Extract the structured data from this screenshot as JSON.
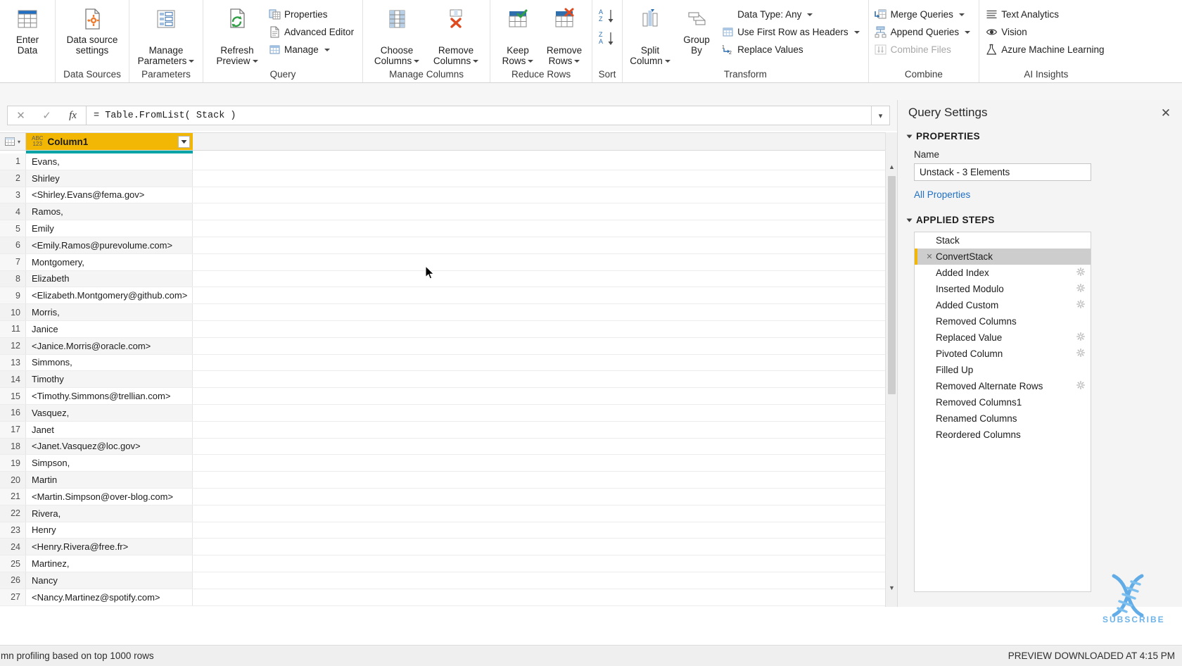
{
  "ribbon": {
    "groups": [
      {
        "name": "clipboard-partial",
        "label": "",
        "buttons": [
          {
            "label": "Enter\nData",
            "icon": "table-icon"
          }
        ]
      },
      {
        "name": "data-sources",
        "label": "Data Sources",
        "buttons": [
          {
            "label": "Data source\nsettings",
            "icon": "data-source-settings-icon"
          }
        ]
      },
      {
        "name": "parameters",
        "label": "Parameters",
        "buttons": [
          {
            "label": "Manage\nParameters",
            "icon": "manage-parameters-icon",
            "dropdown": true
          }
        ]
      },
      {
        "name": "query",
        "label": "Query",
        "buttons": [
          {
            "label": "Refresh\nPreview",
            "icon": "refresh-icon",
            "dropdown": true
          }
        ],
        "small": [
          {
            "label": "Properties",
            "icon": "properties-icon"
          },
          {
            "label": "Advanced Editor",
            "icon": "advanced-editor-icon"
          },
          {
            "label": "Manage",
            "icon": "manage-icon",
            "dropdown": true
          }
        ]
      },
      {
        "name": "manage-columns",
        "label": "Manage Columns",
        "buttons": [
          {
            "label": "Choose\nColumns",
            "icon": "choose-columns-icon",
            "dropdown": true
          },
          {
            "label": "Remove\nColumns",
            "icon": "remove-columns-icon",
            "dropdown": true
          }
        ]
      },
      {
        "name": "reduce-rows",
        "label": "Reduce Rows",
        "buttons": [
          {
            "label": "Keep\nRows",
            "icon": "keep-rows-icon",
            "dropdown": true
          },
          {
            "label": "Remove\nRows",
            "icon": "remove-rows-icon",
            "dropdown": true
          }
        ]
      },
      {
        "name": "sort",
        "label": "Sort",
        "buttons": [
          {
            "label": "",
            "icon": "sort-ascending-icon"
          },
          {
            "label": "",
            "icon": "sort-descending-icon"
          }
        ]
      },
      {
        "name": "transform",
        "label": "Transform",
        "buttons": [
          {
            "label": "Split\nColumn",
            "icon": "split-column-icon",
            "dropdown": true
          },
          {
            "label": "Group\nBy",
            "icon": "group-by-icon"
          }
        ],
        "small": [
          {
            "label": "Data Type: Any",
            "icon": "data-type-icon",
            "dropdown": true
          },
          {
            "label": "Use First Row as Headers",
            "icon": "first-row-headers-icon",
            "dropdown": true
          },
          {
            "label": "Replace Values",
            "icon": "replace-values-icon"
          }
        ]
      },
      {
        "name": "combine",
        "label": "Combine",
        "small": [
          {
            "label": "Merge Queries",
            "icon": "merge-queries-icon",
            "dropdown": true
          },
          {
            "label": "Append Queries",
            "icon": "append-queries-icon",
            "dropdown": true
          },
          {
            "label": "Combine Files",
            "icon": "combine-files-icon",
            "disabled": true
          }
        ]
      },
      {
        "name": "ai-insights",
        "label": "AI Insights",
        "small": [
          {
            "label": "Text Analytics",
            "icon": "text-analytics-icon"
          },
          {
            "label": "Vision",
            "icon": "vision-icon"
          },
          {
            "label": "Azure Machine Learning",
            "icon": "azure-ml-icon"
          }
        ]
      }
    ]
  },
  "formula_bar": {
    "cancel_icon": "cancel-icon",
    "accept_icon": "checkmark-icon",
    "fx_icon": "fx-icon",
    "value": "= Table.FromList( Stack )",
    "expand_icon": "chevron-down-icon"
  },
  "grid": {
    "select_all_icon": "select-all-table-icon",
    "column": {
      "type_icon": "abc123-icon",
      "type_icon_text_top": "ABC",
      "type_icon_text_bottom": "123",
      "name": "Column1",
      "filter_icon": "filter-dropdown-icon",
      "header_bg": "#f2b705",
      "quality_bar_color": "#00a4a6"
    },
    "rows": [
      {
        "n": "1",
        "value": "Evans,"
      },
      {
        "n": "2",
        "value": "Shirley"
      },
      {
        "n": "3",
        "value": "<Shirley.Evans@fema.gov>"
      },
      {
        "n": "4",
        "value": "Ramos,"
      },
      {
        "n": "5",
        "value": "Emily"
      },
      {
        "n": "6",
        "value": "<Emily.Ramos@purevolume.com>"
      },
      {
        "n": "7",
        "value": "Montgomery,"
      },
      {
        "n": "8",
        "value": "Elizabeth"
      },
      {
        "n": "9",
        "value": "<Elizabeth.Montgomery@github.com>"
      },
      {
        "n": "10",
        "value": "Morris,"
      },
      {
        "n": "11",
        "value": "Janice"
      },
      {
        "n": "12",
        "value": "<Janice.Morris@oracle.com>"
      },
      {
        "n": "13",
        "value": "Simmons,"
      },
      {
        "n": "14",
        "value": "Timothy"
      },
      {
        "n": "15",
        "value": "<Timothy.Simmons@trellian.com>"
      },
      {
        "n": "16",
        "value": "Vasquez,"
      },
      {
        "n": "17",
        "value": "Janet"
      },
      {
        "n": "18",
        "value": "<Janet.Vasquez@loc.gov>"
      },
      {
        "n": "19",
        "value": "Simpson,"
      },
      {
        "n": "20",
        "value": "Martin"
      },
      {
        "n": "21",
        "value": "<Martin.Simpson@over-blog.com>"
      },
      {
        "n": "22",
        "value": "Rivera,"
      },
      {
        "n": "23",
        "value": "Henry"
      },
      {
        "n": "24",
        "value": "<Henry.Rivera@free.fr>"
      },
      {
        "n": "25",
        "value": "Martinez,"
      },
      {
        "n": "26",
        "value": "Nancy"
      },
      {
        "n": "27",
        "value": "<Nancy.Martinez@spotify.com>"
      }
    ]
  },
  "query_settings": {
    "title": "Query Settings",
    "close_icon": "close-icon",
    "properties_section": "PROPERTIES",
    "name_label": "Name",
    "name_value": "Unstack - 3 Elements",
    "all_properties_link": "All Properties",
    "applied_steps_section": "APPLIED STEPS",
    "steps": [
      {
        "label": "Stack",
        "selected": false,
        "deletable": false,
        "gear": false
      },
      {
        "label": "ConvertStack",
        "selected": true,
        "deletable": true,
        "gear": false
      },
      {
        "label": "Added Index",
        "selected": false,
        "deletable": false,
        "gear": true
      },
      {
        "label": "Inserted Modulo",
        "selected": false,
        "deletable": false,
        "gear": true
      },
      {
        "label": "Added Custom",
        "selected": false,
        "deletable": false,
        "gear": true
      },
      {
        "label": "Removed Columns",
        "selected": false,
        "deletable": false,
        "gear": false
      },
      {
        "label": "Replaced Value",
        "selected": false,
        "deletable": false,
        "gear": true
      },
      {
        "label": "Pivoted Column",
        "selected": false,
        "deletable": false,
        "gear": true
      },
      {
        "label": "Filled Up",
        "selected": false,
        "deletable": false,
        "gear": false
      },
      {
        "label": "Removed Alternate Rows",
        "selected": false,
        "deletable": false,
        "gear": true
      },
      {
        "label": "Removed Columns1",
        "selected": false,
        "deletable": false,
        "gear": false
      },
      {
        "label": "Renamed Columns",
        "selected": false,
        "deletable": false,
        "gear": false
      },
      {
        "label": "Reordered Columns",
        "selected": false,
        "deletable": false,
        "gear": false
      }
    ]
  },
  "status_bar": {
    "left": "mn profiling based on top 1000 rows",
    "right": "PREVIEW DOWNLOADED AT 4:15 PM"
  },
  "watermark": {
    "icon": "dna-helix-icon",
    "text": "SUBSCRIBE",
    "color": "#6fb4e8"
  },
  "cursor": {
    "icon": "mouse-pointer-icon"
  }
}
